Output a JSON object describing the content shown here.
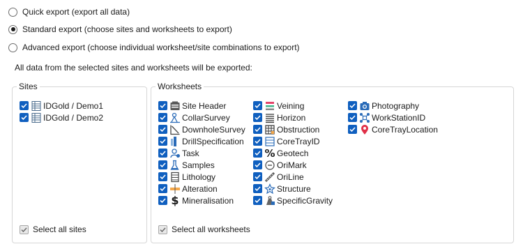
{
  "export_options": [
    {
      "label": "Quick export (export all data)",
      "selected": false
    },
    {
      "label": "Standard export (choose sites and worksheets to export)",
      "selected": true
    },
    {
      "label": "Advanced export (choose individual worksheet/site combinations to export)",
      "selected": false
    }
  ],
  "info_text": "All data from the selected sites and worksheets will be exported:",
  "sites": {
    "title": "Sites",
    "items": [
      {
        "label": "IDGold / Demo1",
        "checked": true,
        "icon": "table-icon"
      },
      {
        "label": "IDGold / Demo2",
        "checked": true,
        "icon": "table-icon"
      }
    ],
    "select_all_label": "Select all sites",
    "select_all_checked": true
  },
  "worksheets": {
    "title": "Worksheets",
    "columns": [
      [
        {
          "label": "Site Header",
          "checked": true,
          "icon": "site-header-icon"
        },
        {
          "label": "CollarSurvey",
          "checked": true,
          "icon": "collar-survey-icon"
        },
        {
          "label": "DownholeSurvey",
          "checked": true,
          "icon": "downhole-survey-icon"
        },
        {
          "label": "DrillSpecification",
          "checked": true,
          "icon": "drill-spec-icon"
        },
        {
          "label": "Task",
          "checked": true,
          "icon": "task-icon"
        },
        {
          "label": "Samples",
          "checked": true,
          "icon": "samples-icon"
        },
        {
          "label": "Lithology",
          "checked": true,
          "icon": "lithology-icon"
        },
        {
          "label": "Alteration",
          "checked": true,
          "icon": "alteration-icon"
        },
        {
          "label": "Mineralisation",
          "checked": true,
          "icon": "dollar-icon"
        }
      ],
      [
        {
          "label": "Veining",
          "checked": true,
          "icon": "veining-icon"
        },
        {
          "label": "Horizon",
          "checked": true,
          "icon": "horizon-icon"
        },
        {
          "label": "Obstruction",
          "checked": true,
          "icon": "obstruction-icon"
        },
        {
          "label": "CoreTrayID",
          "checked": true,
          "icon": "core-tray-icon"
        },
        {
          "label": "Geotech",
          "checked": true,
          "icon": "percent-icon"
        },
        {
          "label": "OriMark",
          "checked": true,
          "icon": "orimark-icon"
        },
        {
          "label": "OriLine",
          "checked": true,
          "icon": "oriline-icon"
        },
        {
          "label": "Structure",
          "checked": true,
          "icon": "structure-icon"
        },
        {
          "label": "SpecificGravity",
          "checked": true,
          "icon": "specific-gravity-icon"
        }
      ],
      [
        {
          "label": "Photography",
          "checked": true,
          "icon": "camera-icon"
        },
        {
          "label": "WorkStationID",
          "checked": true,
          "icon": "workstation-icon"
        },
        {
          "label": "CoreTrayLocation",
          "checked": true,
          "icon": "map-pin-icon"
        }
      ]
    ],
    "select_all_label": "Select all worksheets",
    "select_all_checked": true
  }
}
